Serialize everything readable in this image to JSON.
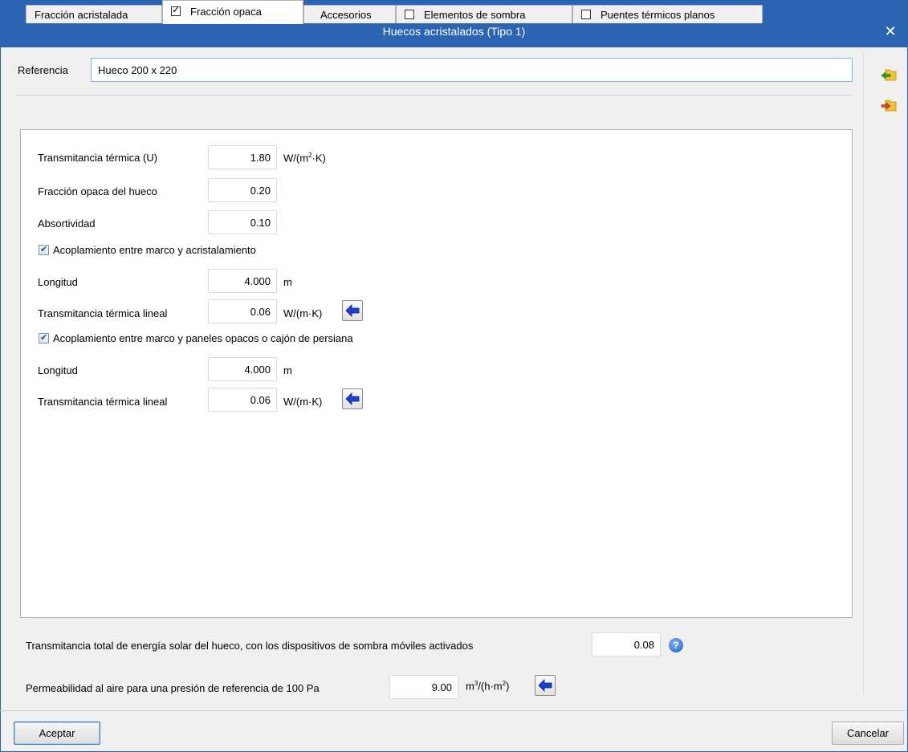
{
  "window": {
    "title": "Huecos acristalados (Tipo 1)",
    "close_glyph": "✕"
  },
  "reference": {
    "label": "Referencia",
    "value": "Hueco 200 x 220"
  },
  "tabs": [
    {
      "label": "Fracción acristalada",
      "has_checkbox": false,
      "checked": false,
      "active": false
    },
    {
      "label": "Fracción opaca",
      "has_checkbox": true,
      "checked": true,
      "active": true
    },
    {
      "label": "Accesorios",
      "has_checkbox": false,
      "checked": false,
      "active": false
    },
    {
      "label": "Elementos de sombra",
      "has_checkbox": true,
      "checked": false,
      "active": false
    },
    {
      "label": "Puentes térmicos planos",
      "has_checkbox": true,
      "checked": false,
      "active": false
    }
  ],
  "opaque": {
    "u_label": "Transmitancia térmica (U)",
    "u_value": "1.80",
    "u_unit_prefix": "W/(m",
    "u_unit_sup": "2",
    "u_unit_suffix": "·K)",
    "fraction_label": "Fracción opaca del hueco",
    "fraction_value": "0.20",
    "absorptivity_label": "Absortividad",
    "absorptivity_value": "0.10",
    "coupling1_label": "Acoplamiento entre marco y acristalamiento",
    "coupling1_checked": true,
    "length1_label": "Longitud",
    "length1_value": "4.000",
    "length1_unit": "m",
    "psi1_label": "Transmitancia térmica lineal",
    "psi1_value": "0.06",
    "psi1_unit": "W/(m·K)",
    "coupling2_label": "Acoplamiento entre marco y paneles opacos o cajón de persiana",
    "coupling2_checked": true,
    "length2_label": "Longitud",
    "length2_value": "4.000",
    "length2_unit": "m",
    "psi2_label": "Transmitancia térmica lineal",
    "psi2_value": "0.06",
    "psi2_unit": "W/(m·K)"
  },
  "solar": {
    "label": "Transmitancia total de energía solar del hueco, con los dispositivos de sombra móviles activados",
    "value": "0.08",
    "help_glyph": "?"
  },
  "permeability": {
    "label": "Permeabilidad al aire para una presión de referencia de 100 Pa",
    "value": "9.00",
    "unit_a": "m",
    "unit_sup1": "3",
    "unit_b": "/(h·m",
    "unit_sup2": "2",
    "unit_c": ")"
  },
  "buttons": {
    "accept": "Aceptar",
    "cancel": "Cancelar"
  },
  "colors": {
    "titlebar": "#2b64b2",
    "arrow_blue": "#1c3fd6",
    "arrow_green": "#3a9b1f",
    "arrow_red": "#d44a2a",
    "folder_yellow": "#f2c230"
  }
}
